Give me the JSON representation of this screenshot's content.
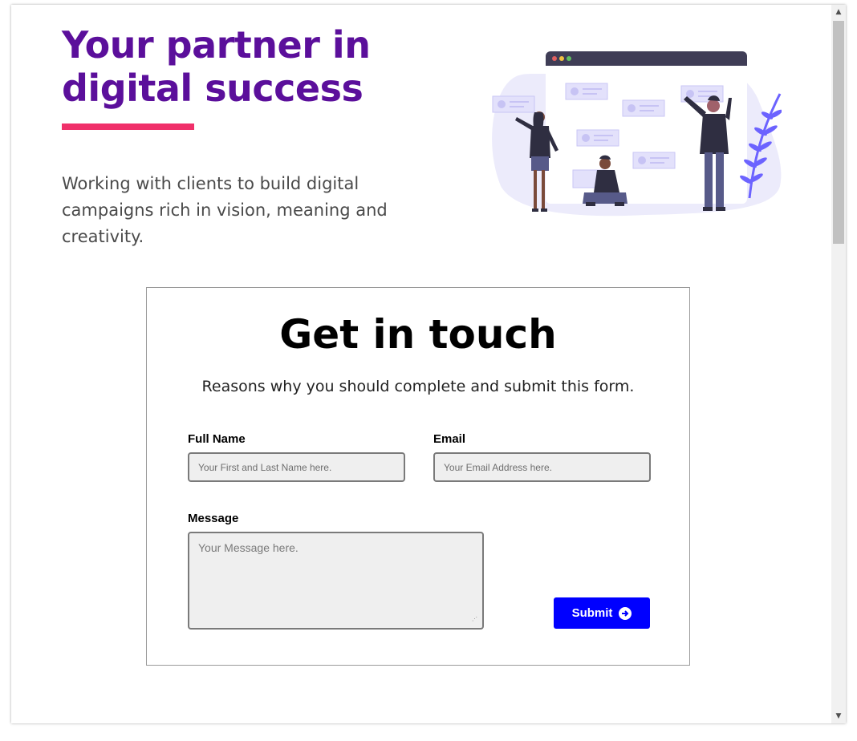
{
  "hero": {
    "title": "Your partner in digital success",
    "subtitle": "Working with clients to build digital campaigns rich in vision, meaning and creativity.",
    "illustration_icon": "team-collaboration-illustration"
  },
  "contact": {
    "title": "Get in touch",
    "subtitle": "Reasons why you should complete and submit this form.",
    "full_name": {
      "label": "Full Name",
      "placeholder": "Your First and Last Name here.",
      "value": ""
    },
    "email": {
      "label": "Email",
      "placeholder": "Your Email Address here.",
      "value": ""
    },
    "message": {
      "label": "Message",
      "placeholder": "Your Message here.",
      "value": ""
    },
    "submit": {
      "label": "Submit",
      "icon": "arrow-circle-right-icon"
    }
  },
  "colors": {
    "title_purple": "#5b0f9b",
    "accent_pink": "#f0306a",
    "button_blue": "#0000ff",
    "illustration_purple": "#6c63ff"
  }
}
